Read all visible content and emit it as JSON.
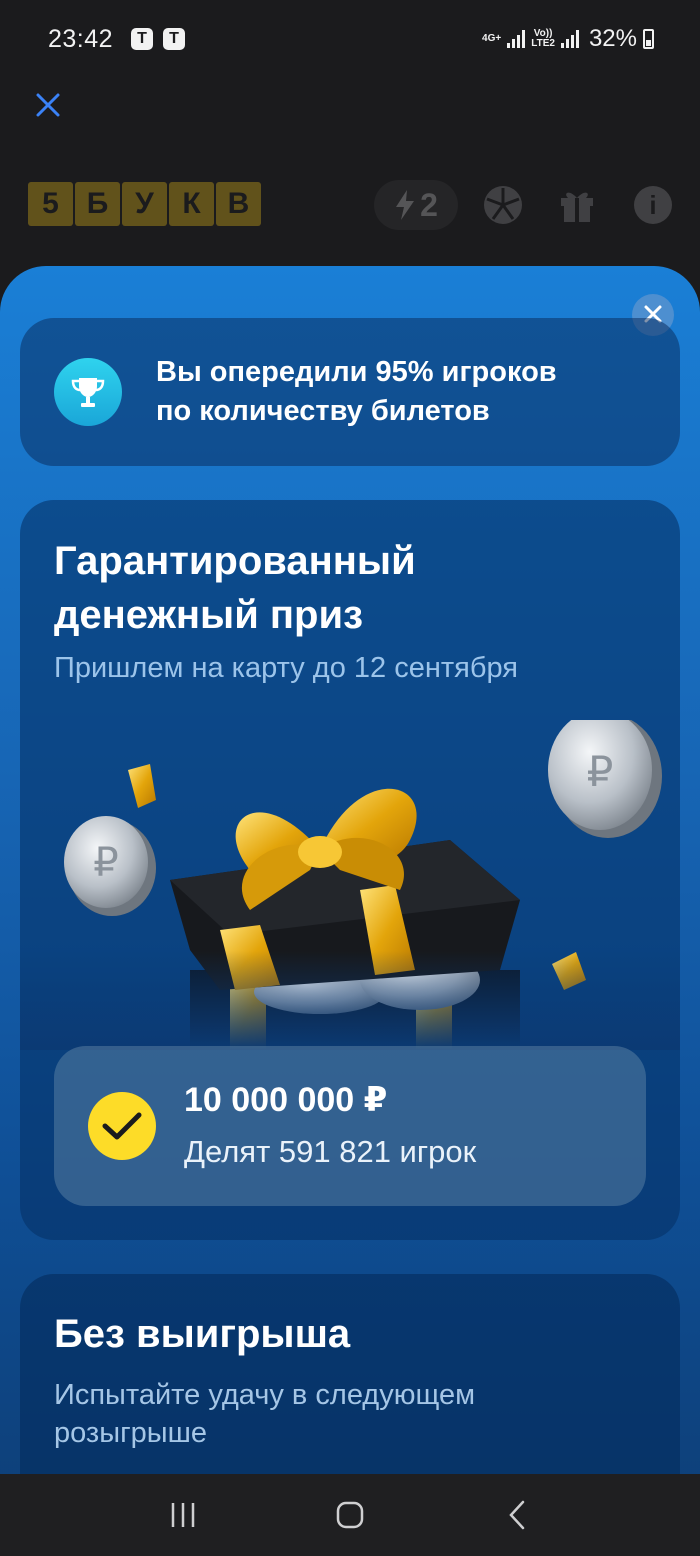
{
  "status_bar": {
    "time": "23:42",
    "carrier_badges": [
      "T",
      "T"
    ],
    "network_1": "4G+",
    "network_2_top": "Vo))",
    "network_2_bottom": "LTE2",
    "battery_percent": "32%",
    "battery_level": 0.32
  },
  "toolbar": {
    "close_icon": "close-icon"
  },
  "game_header": {
    "logo_letters": [
      "5",
      "Б",
      "У",
      "К",
      "В"
    ],
    "energy_count": "2",
    "icons": [
      "bolt-icon",
      "wheel-icon",
      "gift-icon",
      "info-icon"
    ]
  },
  "sheet": {
    "rank_card": {
      "line1": "Вы опередили 95% игроков",
      "line2": "по количеству билетов"
    },
    "prize_card": {
      "title": "Гарантированный денежный приз",
      "subtitle": "Пришлем на карту до 12 сентября",
      "amount": "10 000 000 ₽",
      "shared_by": "Делят 591 821 игрок"
    },
    "nowin_card": {
      "title": "Без выигрыша",
      "subtitle": "Испытайте удачу в следующем розыгрыше"
    }
  },
  "colors": {
    "accent_blue": "#3b82f6",
    "logo_yellow": "#f5c518",
    "check_yellow": "#fddc28",
    "sheet_top": "#1a7fd6",
    "sheet_bottom": "#0d3d74"
  },
  "nav_bar": {
    "buttons": [
      "recents-icon",
      "home-icon",
      "back-icon"
    ]
  }
}
